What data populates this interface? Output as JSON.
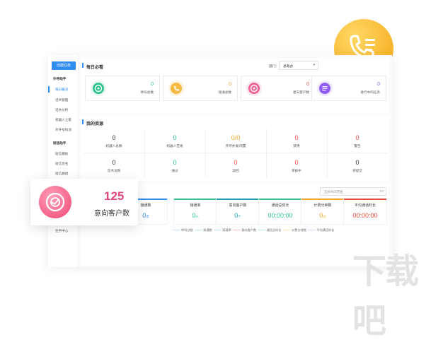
{
  "sidebar": {
    "create_label": "创建任务",
    "groups": [
      {
        "label": "外呼助手",
        "items": [
          "每日概况",
          "话术管理",
          "话术分析",
          "机器人之家",
          "外呼号码池"
        ]
      },
      {
        "label": "短信助手",
        "items": [
          "短信模板",
          "短信签名",
          "短信群组"
        ]
      }
    ],
    "bottom_item": "任务中心"
  },
  "daily": {
    "title": "每日必看",
    "dept_label": "部门：",
    "dept_value": "总裁办",
    "cards": [
      {
        "value": "0",
        "label": "呼叫总数",
        "color": "#31c48d",
        "icon": "target-icon"
      },
      {
        "value": "0",
        "label": "接通总数",
        "color": "#f5b942",
        "icon": "phone-icon"
      },
      {
        "value": "0",
        "label": "意向客户数",
        "color": "#f06292",
        "icon": "target-icon"
      },
      {
        "value": "0",
        "label": "进行中的任务",
        "color": "#8e5cf2",
        "icon": "list-icon"
      }
    ]
  },
  "resources": {
    "title": "我的资源",
    "rows": [
      [
        {
          "value": "0",
          "label": "机器人总数",
          "color": "#333333"
        },
        {
          "value": "0",
          "label": "机器人在线",
          "color": "#31c48d"
        },
        {
          "value": "0/0",
          "label": "外呼并发/闲置",
          "color": "#f5a623"
        },
        {
          "value": "0",
          "label": "禁用",
          "color": "#e74c3c"
        },
        {
          "value": "0",
          "label": "警告",
          "color": "#e74c3c"
        }
      ],
      [
        {
          "value": "0",
          "label": "话术总数",
          "color": "#333333"
        },
        {
          "value": "0",
          "label": "通过",
          "color": "#31c48d"
        },
        {
          "value": "0",
          "label": "驳回",
          "color": "#e74c3c"
        },
        {
          "value": "0",
          "label": "审核中",
          "color": "#e74c3c"
        },
        {
          "value": "0",
          "label": "待提交",
          "color": "#333333"
        }
      ]
    ]
  },
  "stats": {
    "date_placeholder": "选择时间范围",
    "items": [
      {
        "label": "接通数",
        "value": "0",
        "unit": "次",
        "color": "#2f8cf0"
      },
      {
        "label": "接通率",
        "value": "0",
        "unit": "%",
        "color": "#31c48d"
      },
      {
        "label": "意向客户数",
        "value": "0",
        "unit": "个",
        "color": "#17a2b8"
      },
      {
        "label": "通话总时长",
        "value": "00:00:00",
        "unit": "",
        "color": "#31c48d"
      },
      {
        "label": "计费分钟数",
        "value": "0",
        "unit": "分",
        "color": "#f5a623"
      },
      {
        "label": "平均通话时长",
        "value": "00:00:00",
        "unit": "",
        "color": "#e74c3c"
      }
    ],
    "legend": [
      {
        "label": "呼叫总数",
        "color": "#2f8cf0"
      },
      {
        "label": "接通数",
        "color": "#31c48d"
      },
      {
        "label": "接通率",
        "color": "#17a2b8"
      },
      {
        "label": "意向客户数",
        "color": "#e74c3c"
      },
      {
        "label": "通话总时长",
        "color": "#20c997"
      },
      {
        "label": "计费分钟数",
        "color": "#f5a623"
      },
      {
        "label": "平均通话时长",
        "color": "#a55eea"
      }
    ]
  },
  "float_card": {
    "value": "125",
    "label": "意向客户数"
  },
  "watermark": "下载吧"
}
